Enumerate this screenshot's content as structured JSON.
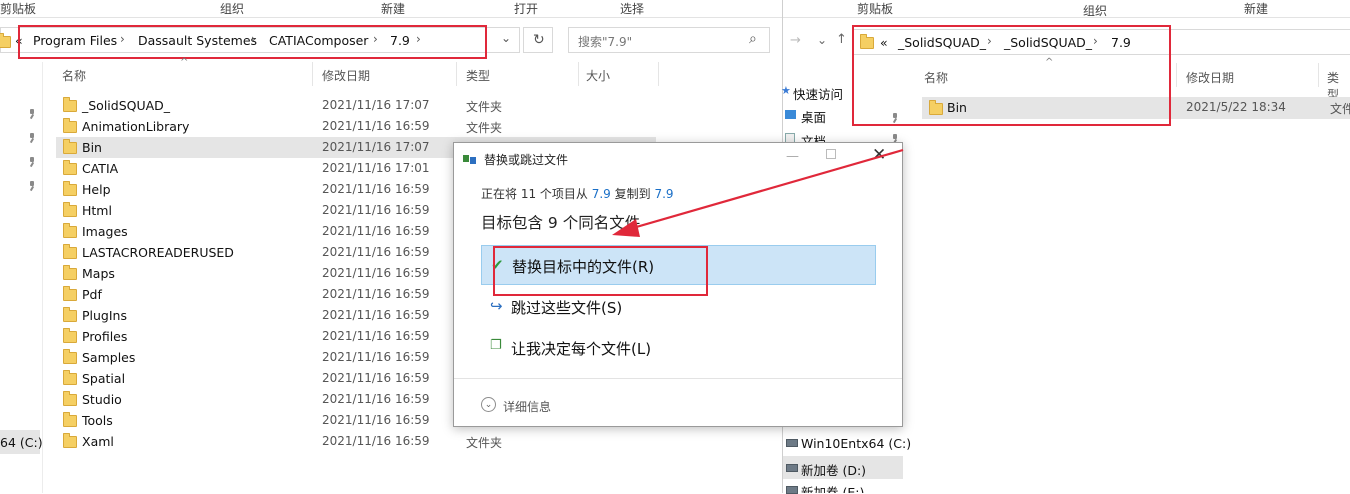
{
  "left_window": {
    "ribbon": {
      "clipboard": "剪贴板",
      "organize": "组织",
      "new": "新建",
      "open": "打开",
      "select": "选择"
    },
    "address": {
      "nav_back": "«",
      "crumbs": [
        "Program Files",
        "Dassault Systemes",
        "CATIAComposer",
        "7.9"
      ]
    },
    "search": {
      "placeholder": "搜索\"7.9\""
    },
    "columns": {
      "name": "名称",
      "date": "修改日期",
      "type": "类型",
      "size": "大小"
    },
    "files": [
      {
        "name": "_SolidSQUAD_",
        "date": "2021/11/16 17:07",
        "type": "文件夹"
      },
      {
        "name": "AnimationLibrary",
        "date": "2021/11/16 16:59",
        "type": "文件夹"
      },
      {
        "name": "Bin",
        "date": "2021/11/16 17:07",
        "type": ""
      },
      {
        "name": "CATIA",
        "date": "2021/11/16 17:01",
        "type": ""
      },
      {
        "name": "Help",
        "date": "2021/11/16 16:59",
        "type": ""
      },
      {
        "name": "Html",
        "date": "2021/11/16 16:59",
        "type": ""
      },
      {
        "name": "Images",
        "date": "2021/11/16 16:59",
        "type": ""
      },
      {
        "name": "LASTACROREADERUSED",
        "date": "2021/11/16 16:59",
        "type": ""
      },
      {
        "name": "Maps",
        "date": "2021/11/16 16:59",
        "type": ""
      },
      {
        "name": "Pdf",
        "date": "2021/11/16 16:59",
        "type": ""
      },
      {
        "name": "PlugIns",
        "date": "2021/11/16 16:59",
        "type": ""
      },
      {
        "name": "Profiles",
        "date": "2021/11/16 16:59",
        "type": ""
      },
      {
        "name": "Samples",
        "date": "2021/11/16 16:59",
        "type": ""
      },
      {
        "name": "Spatial",
        "date": "2021/11/16 16:59",
        "type": ""
      },
      {
        "name": "Studio",
        "date": "2021/11/16 16:59",
        "type": ""
      },
      {
        "name": "Tools",
        "date": "2021/11/16 16:59",
        "type": ""
      },
      {
        "name": "Xaml",
        "date": "2021/11/16 16:59",
        "type": "文件夹"
      }
    ],
    "nav_drive": "64 (C:)"
  },
  "right_window": {
    "ribbon": {
      "clipboard": "剪贴板",
      "organize": "组织",
      "new": "新建"
    },
    "address": {
      "nav_back": "«",
      "crumbs": [
        "_SolidSQUAD_",
        "_SolidSQUAD_",
        "7.9"
      ]
    },
    "columns": {
      "name": "名称",
      "date": "修改日期",
      "type": "类型"
    },
    "files": [
      {
        "name": "Bin",
        "date": "2021/5/22 18:34",
        "type": "文件"
      }
    ],
    "nav": {
      "quick_access": "快速访问",
      "desktop": "桌面",
      "documents": "文档",
      "drive_c": "Win10Entx64 (C:)",
      "drive_d": "新加卷 (D:)",
      "drive_e": "新加卷 (E:)"
    }
  },
  "dialog": {
    "title": "替换或跳过文件",
    "sub_prefix": "正在将 11 个项目从 ",
    "sub_src": "7.9",
    "sub_mid": " 复制到 ",
    "sub_dst": "7.9",
    "heading": "目标包含 9 个同名文件",
    "options": {
      "replace": "替换目标中的文件(R)",
      "skip": "跳过这些文件(S)",
      "decide": "让我决定每个文件(L)"
    },
    "details": "详细信息"
  },
  "colors": {
    "annotation_red": "#e0283a",
    "selection_blue": "#cce4f7",
    "link_blue": "#1a6fc7"
  }
}
